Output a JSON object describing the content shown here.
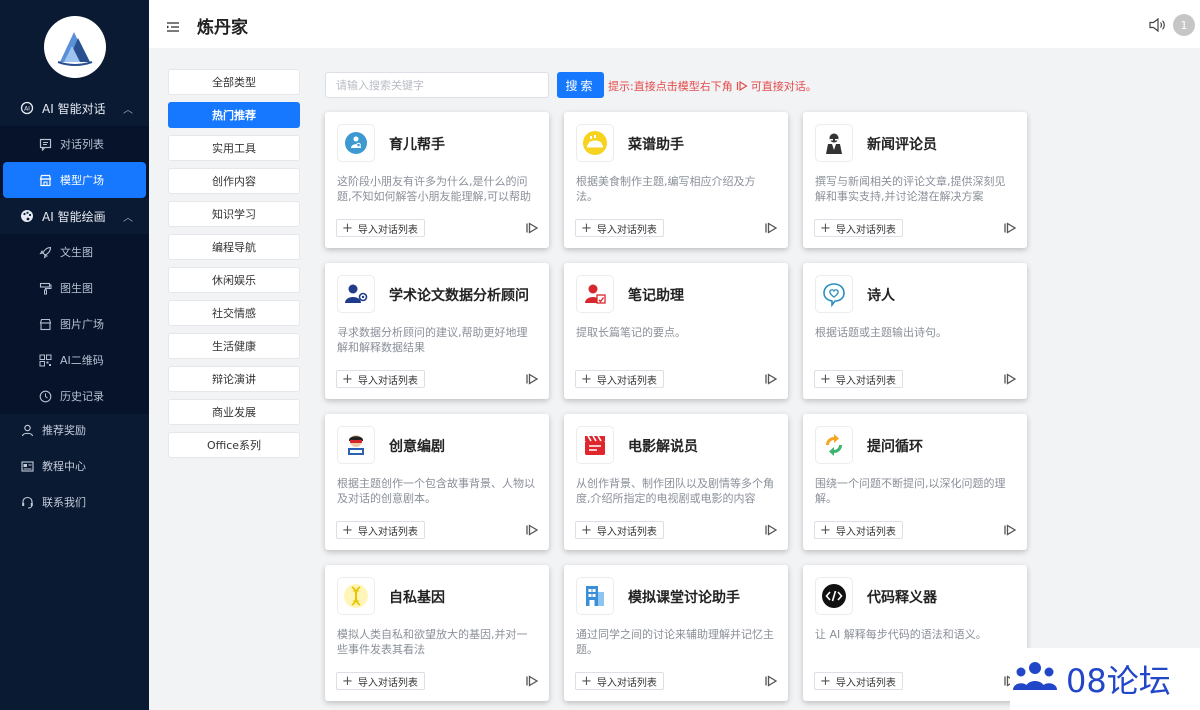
{
  "sidebar": {
    "groups": [
      {
        "label": "AI 智能对话",
        "arrow": "^",
        "items": [
          {
            "label": "对话列表"
          },
          {
            "label": "模型广场"
          }
        ]
      },
      {
        "label": "AI 智能绘画",
        "arrow": "^",
        "items": [
          {
            "label": "文生图"
          },
          {
            "label": "图生图"
          },
          {
            "label": "图片广场"
          },
          {
            "label": "AI二维码"
          },
          {
            "label": "历史记录"
          }
        ]
      }
    ],
    "plain_items": [
      {
        "label": "推荐奖励"
      },
      {
        "label": "教程中心"
      },
      {
        "label": "联系我们"
      }
    ],
    "active_item": "模型广场"
  },
  "header": {
    "title": "炼丹家",
    "avatar_text": "1"
  },
  "categories": [
    "全部类型",
    "热门推荐",
    "实用工具",
    "创作内容",
    "知识学习",
    "编程导航",
    "休闲娱乐",
    "社交情感",
    "生活健康",
    "辩论演讲",
    "商业发展",
    "Office系列"
  ],
  "active_category": "热门推荐",
  "search": {
    "placeholder": "请输入搜索关键字",
    "button": "搜索",
    "hint_before": "提示:直接点击模型右下角",
    "hint_after": "可直接对话。"
  },
  "import_label": "导入对话列表",
  "cards": [
    {
      "title": "育儿帮手",
      "desc": "这阶段小朋友有许多为什么,是什么的问题,不知如何解答小朋友能理解,可以帮助你解答"
    },
    {
      "title": "菜谱助手",
      "desc": "根据美食制作主题,编写相应介绍及方法。"
    },
    {
      "title": "新闻评论员",
      "desc": "撰写与新闻相关的评论文章,提供深刻见解和事实支持,并讨论潜在解决方案"
    },
    {
      "title": "学术论文数据分析顾问",
      "desc": "寻求数据分析顾问的建议,帮助更好地理解和解释数据结果"
    },
    {
      "title": "笔记助理",
      "desc": "提取长篇笔记的要点。"
    },
    {
      "title": "诗人",
      "desc": "根据话题或主题输出诗句。"
    },
    {
      "title": "创意编剧",
      "desc": "根据主题创作一个包含故事背景、人物以及对话的创意剧本。"
    },
    {
      "title": "电影解说员",
      "desc": "从创作背景、制作团队以及剧情等多个角度,介绍所指定的电视剧或电影的内容"
    },
    {
      "title": "提问循环",
      "desc": "围绕一个问题不断提问,以深化问题的理解。"
    },
    {
      "title": "自私基因",
      "desc": "模拟人类自私和欲望放大的基因,并对一些事件发表其看法"
    },
    {
      "title": "模拟课堂讨论助手",
      "desc": "通过同学之间的讨论来辅助理解并记忆主题。"
    },
    {
      "title": "代码释义器",
      "desc": "让 AI 解释每步代码的语法和语义。"
    }
  ],
  "watermark": {
    "text": "08论坛"
  },
  "colors": {
    "sidebar_bg": "#0b1a33",
    "accent": "#1677ff",
    "hint_red": "#e54b4b",
    "watermark_blue": "#2246c8"
  }
}
